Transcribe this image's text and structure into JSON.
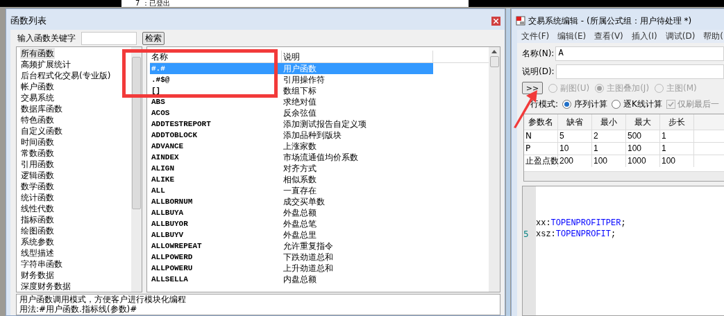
{
  "background": {
    "status_text": "7 ：已登出"
  },
  "function_dialog": {
    "title": "函数列表",
    "keyword_label": "输入函数关键字",
    "search_button": "检索",
    "categories": [
      {
        "label": "所有函数",
        "selected": true
      },
      {
        "label": "高频扩展统计",
        "selected": false
      },
      {
        "label": "后台程式化交易(专业版)",
        "selected": false
      },
      {
        "label": "帐户函数",
        "selected": false
      },
      {
        "label": "交易系统",
        "selected": false
      },
      {
        "label": "数据库函数",
        "selected": false
      },
      {
        "label": "特色函数",
        "selected": false
      },
      {
        "label": "自定义函数",
        "selected": false
      },
      {
        "label": "时间函数",
        "selected": false
      },
      {
        "label": "常数函数",
        "selected": false
      },
      {
        "label": "引用函数",
        "selected": false
      },
      {
        "label": "逻辑函数",
        "selected": false
      },
      {
        "label": "数学函数",
        "selected": false
      },
      {
        "label": "统计函数",
        "selected": false
      },
      {
        "label": "线性代数",
        "selected": false
      },
      {
        "label": "指标函数",
        "selected": false
      },
      {
        "label": "绘图函数",
        "selected": false
      },
      {
        "label": "系统参数",
        "selected": false
      },
      {
        "label": "线型描述",
        "selected": false
      },
      {
        "label": "字符串函数",
        "selected": false
      },
      {
        "label": "财务数据",
        "selected": false
      },
      {
        "label": "深度财务数据",
        "selected": false
      }
    ],
    "table": {
      "columns": [
        "名称",
        "说明"
      ],
      "rows": [
        {
          "name": "#.#",
          "description": "用户函数",
          "selected": true
        },
        {
          "name": ".#$@",
          "description": "引用操作符",
          "selected": false
        },
        {
          "name": "[]",
          "description": "数组下标",
          "selected": false
        },
        {
          "name": "ABS",
          "description": "求绝对值",
          "selected": false
        },
        {
          "name": "ACOS",
          "description": "反余弦值",
          "selected": false
        },
        {
          "name": "ADDTESTREPORT",
          "description": "添加测试报告自定义项",
          "selected": false
        },
        {
          "name": "ADDTOBLOCK",
          "description": "添加品种到版块",
          "selected": false
        },
        {
          "name": "ADVANCE",
          "description": "上涨家数",
          "selected": false
        },
        {
          "name": "AINDEX",
          "description": "市场流通值均价系数",
          "selected": false
        },
        {
          "name": "ALIGN",
          "description": "对齐方式",
          "selected": false
        },
        {
          "name": "ALIKE",
          "description": "相似系数",
          "selected": false
        },
        {
          "name": "ALL",
          "description": "一直存在",
          "selected": false
        },
        {
          "name": "ALLBORNUM",
          "description": "成交买单数",
          "selected": false
        },
        {
          "name": "ALLBUYA",
          "description": "外盘总额",
          "selected": false
        },
        {
          "name": "ALLBUYOR",
          "description": "外盘总笔",
          "selected": false
        },
        {
          "name": "ALLBUYV",
          "description": "外盘总里",
          "selected": false
        },
        {
          "name": "ALLOWREPEAT",
          "description": "允许重复指令",
          "selected": false
        },
        {
          "name": "ALLPOWERD",
          "description": "下跌劲道总和",
          "selected": false
        },
        {
          "name": "ALLPOWERU",
          "description": "上升劲道总和",
          "selected": false
        },
        {
          "name": "ALLSELLA",
          "description": "内盘总额",
          "selected": false
        }
      ]
    },
    "description_lines": [
      "用户函数调用模式，方便客户进行模块化编程",
      "用法:#用户函数.指标线(参数)#"
    ]
  },
  "editor_window": {
    "title": "交易系统编辑 - (所属公式组：用户待处理 *)",
    "menu": [
      "文件(F)",
      "编辑(E)",
      "查看(V)",
      "插入(I)",
      "调试(D)",
      "帮助("
    ],
    "name_label": "名称(N):",
    "name_value": "A",
    "desc_label": "说明(D):",
    "expand_button": ">>",
    "chart_options": [
      {
        "label": "副图(U)",
        "selected": false,
        "disabled": true
      },
      {
        "label": "主图叠加(J)",
        "selected": true,
        "disabled": true
      },
      {
        "label": "主图(M)",
        "selected": false,
        "disabled": true
      }
    ],
    "mode_label": "行模式:",
    "mode_options": [
      {
        "label": "序列计算",
        "selected": true
      },
      {
        "label": "逐K线计算",
        "selected": false
      }
    ],
    "refresh_option": {
      "label": "仅刷最后一",
      "checked": true,
      "disabled": true
    },
    "params": {
      "columns": [
        "参数名",
        "缺省",
        "最小",
        "最大",
        "步长"
      ],
      "rows": [
        [
          "N",
          "5",
          "2",
          "500",
          "1"
        ],
        [
          "P",
          "10",
          "1",
          "100",
          "1"
        ],
        [
          "止盈点数",
          "200",
          "100",
          "1000",
          "100"
        ]
      ]
    },
    "code_lines": [
      {
        "tokens": [
          {
            "text": "xx:",
            "kind": "plain"
          },
          {
            "text": "TOPENPROFITPER",
            "kind": "function"
          },
          {
            "text": ";",
            "kind": "plain"
          }
        ]
      },
      {
        "number": "5",
        "tokens": [
          {
            "text": "xsz:",
            "kind": "plain"
          },
          {
            "text": "TOPENPROFIT",
            "kind": "function"
          },
          {
            "text": ";",
            "kind": "plain"
          }
        ]
      }
    ]
  }
}
